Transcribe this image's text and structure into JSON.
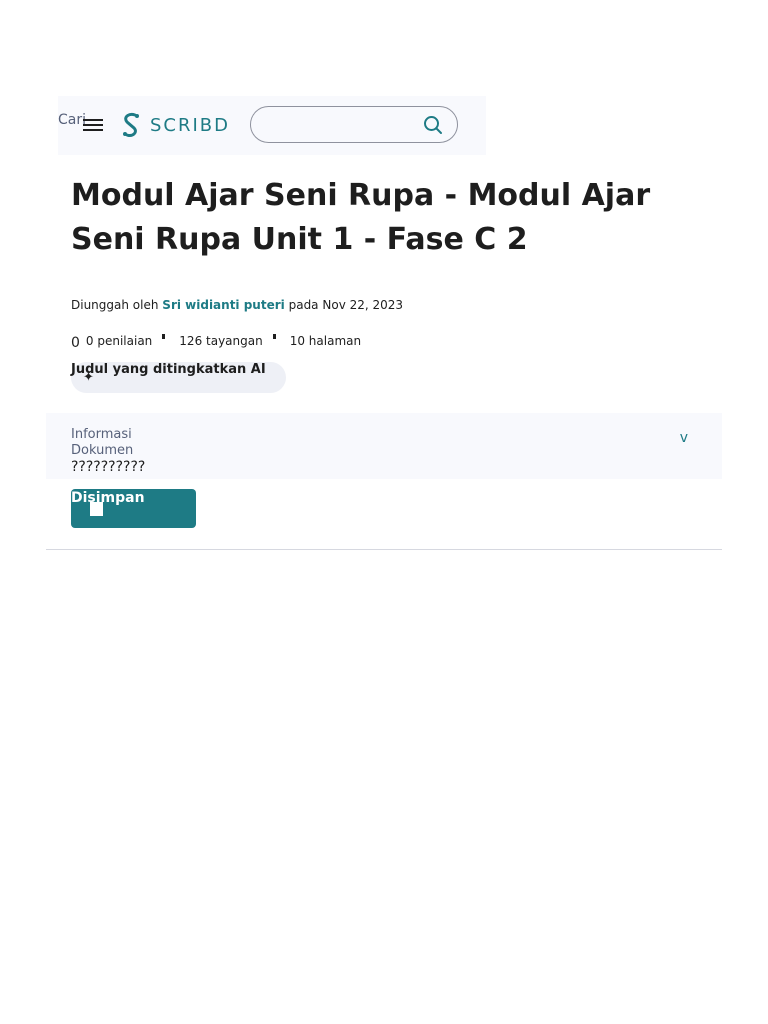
{
  "header": {
    "search_label": "Cari",
    "menu_icon": "hamburger-menu-icon",
    "logo_text": "SCRIBD",
    "search": {
      "value": "",
      "placeholder": ""
    },
    "search_icon": "search-icon"
  },
  "document": {
    "title": "Modul Ajar Seni Rupa - Modul Ajar Seni Rupa Unit 1 - Fase C 2",
    "uploaded_prefix": "Diunggah oleh",
    "uploader": "Sri widianti puteri",
    "date_prefix": "pada",
    "date": "Nov 22, 2023",
    "rating_value": "0",
    "ratings": "0 penilaian",
    "views": "126 tayangan",
    "pages": "10 halaman"
  },
  "ai_title": {
    "label": "Judul yang ditingkatkan AI",
    "icon": "sparkle-icon"
  },
  "info": {
    "title": "Informasi Dokumen",
    "chevron": "v",
    "text": "??????????"
  },
  "save": {
    "label": "Disimpan",
    "icon": "bookmark-icon"
  },
  "colors": {
    "accent": "#1e7b85",
    "header_bg": "#f8f9fd",
    "text": "#1e1e1e"
  }
}
